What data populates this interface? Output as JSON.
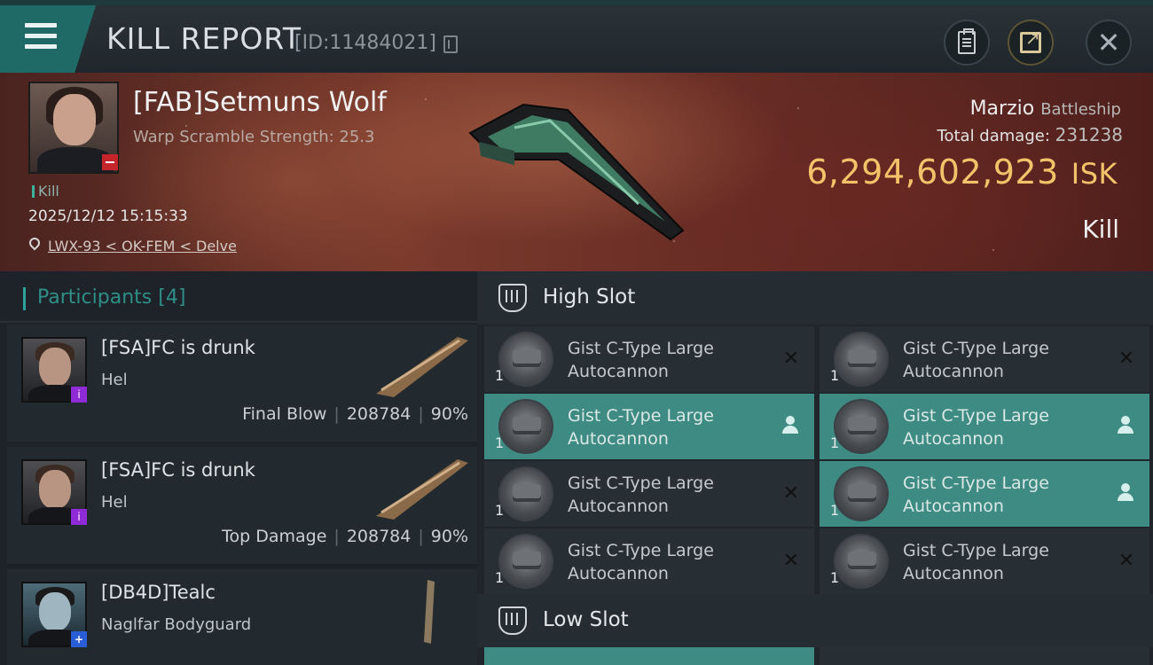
{
  "header": {
    "title": "KILL REPORT",
    "report_id": "[ID:11484021]",
    "menu_icon": "hamburger-menu-icon",
    "buttons": [
      "clipboard-icon",
      "share-icon",
      "close-icon"
    ]
  },
  "victim": {
    "name": "[FAB]Setmuns Wolf",
    "warp_scramble": "Warp Scramble Strength: 25.3",
    "tag": "Kill",
    "date": "2025/12/12 15:15:33",
    "location": "LWX-93 < OK-FEM < Delve",
    "ship_name": "Marzio",
    "ship_class": "Battleship",
    "total_damage_label": "Total damage:",
    "total_damage_value": "231238",
    "isk_value": "6,294,602,923",
    "isk_unit": "ISK",
    "result": "Kill"
  },
  "participants": {
    "title": "Participants",
    "count": "[4]",
    "rows": [
      {
        "name": "[FSA]FC is drunk",
        "ship": "Hel",
        "role": "Final Blow",
        "damage": "208784",
        "percent": "90%",
        "badge": "i",
        "badge_color": "#8e2bd6"
      },
      {
        "name": "[FSA]FC is drunk",
        "ship": "Hel",
        "role": "Top Damage",
        "damage": "208784",
        "percent": "90%",
        "badge": "i",
        "badge_color": "#8e2bd6"
      },
      {
        "name": "[DB4D]Tealc",
        "ship": "Naglfar Bodyguard",
        "role": "",
        "damage": "",
        "percent": "",
        "badge": "+",
        "badge_color": "#2a5ed6"
      }
    ]
  },
  "fitting": {
    "high_slot_title": "High Slot",
    "low_slot_title": "Low Slot",
    "high_modules": [
      {
        "line1": "Gist C-Type Large",
        "line2": "Autocannon",
        "qty": "1",
        "state": "destroyed"
      },
      {
        "line1": "Gist C-Type Large",
        "line2": "Autocannon",
        "qty": "1",
        "state": "destroyed"
      },
      {
        "line1": "Gist C-Type Large",
        "line2": "Autocannon",
        "qty": "1",
        "state": "dropped"
      },
      {
        "line1": "Gist C-Type Large",
        "line2": "Autocannon",
        "qty": "1",
        "state": "dropped"
      },
      {
        "line1": "Gist C-Type Large",
        "line2": "Autocannon",
        "qty": "1",
        "state": "destroyed"
      },
      {
        "line1": "Gist C-Type Large",
        "line2": "Autocannon",
        "qty": "1",
        "state": "dropped"
      },
      {
        "line1": "Gist C-Type Large",
        "line2": "Autocannon",
        "qty": "1",
        "state": "destroyed"
      },
      {
        "line1": "Gist C-Type Large",
        "line2": "Autocannon",
        "qty": "1",
        "state": "destroyed"
      }
    ],
    "colors": {
      "dropped": "#3d8b82",
      "destroyed": "#282f34",
      "accent_gold": "#f3c36a",
      "accent_teal": "#2ea399"
    }
  }
}
